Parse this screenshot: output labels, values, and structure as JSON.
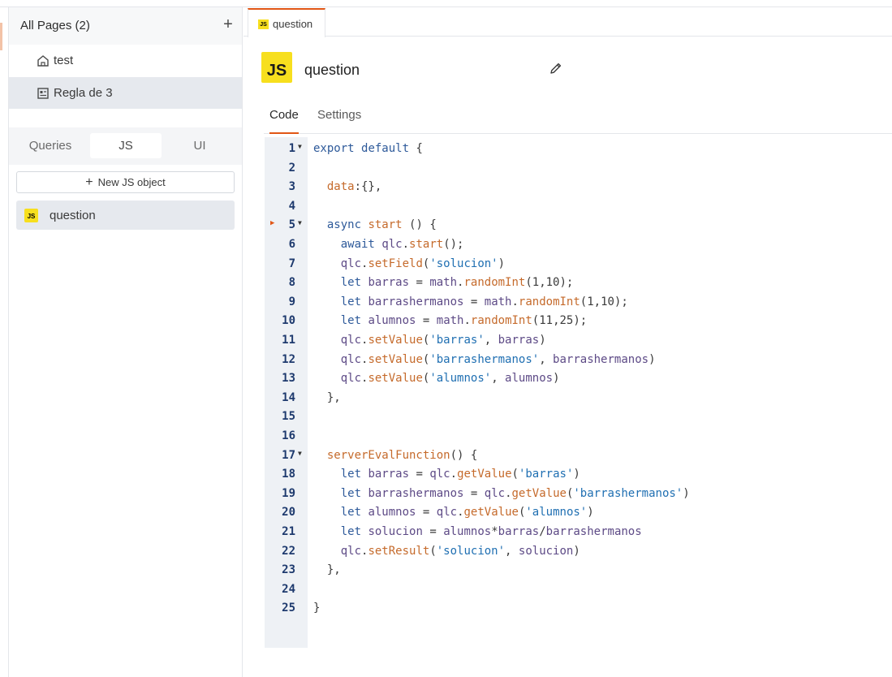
{
  "sidebar": {
    "pages_title": "All Pages (2)",
    "add_icon": "+",
    "pages": [
      {
        "label": "test",
        "icon": "home-icon",
        "active": false
      },
      {
        "label": "Regla de 3",
        "icon": "page-icon",
        "active": true
      }
    ],
    "segment_tabs": [
      {
        "label": "Queries",
        "active": false
      },
      {
        "label": "JS",
        "active": true
      },
      {
        "label": "UI",
        "active": false
      }
    ],
    "new_js_label": "New JS object",
    "js_objects": [
      {
        "label": "question",
        "badge": "JS"
      }
    ]
  },
  "tabbar": {
    "file_tab_label": "question",
    "file_tab_badge": "JS"
  },
  "header": {
    "badge": "JS",
    "title": "question"
  },
  "subtabs": [
    {
      "label": "Code",
      "active": true
    },
    {
      "label": "Settings",
      "active": false
    }
  ],
  "editor": {
    "lines": [
      {
        "n": "1",
        "fold": true,
        "text": "export default {"
      },
      {
        "n": "2",
        "text": ""
      },
      {
        "n": "3",
        "text": "  data:{},"
      },
      {
        "n": "4",
        "text": ""
      },
      {
        "n": "5",
        "fold": true,
        "breakpoint": true,
        "text": "  async start () {"
      },
      {
        "n": "6",
        "text": "    await qlc.start();"
      },
      {
        "n": "7",
        "text": "    qlc.setField('solucion')"
      },
      {
        "n": "8",
        "text": "    let barras = math.randomInt(1,10);"
      },
      {
        "n": "9",
        "text": "    let barrashermanos = math.randomInt(1,10);"
      },
      {
        "n": "10",
        "text": "    let alumnos = math.randomInt(11,25);"
      },
      {
        "n": "11",
        "text": "    qlc.setValue('barras', barras)"
      },
      {
        "n": "12",
        "text": "    qlc.setValue('barrashermanos', barrashermanos)"
      },
      {
        "n": "13",
        "text": "    qlc.setValue('alumnos', alumnos)"
      },
      {
        "n": "14",
        "text": "  },"
      },
      {
        "n": "15",
        "text": ""
      },
      {
        "n": "16",
        "text": ""
      },
      {
        "n": "17",
        "fold": true,
        "text": "  serverEvalFunction() {"
      },
      {
        "n": "18",
        "text": "    let barras = qlc.getValue('barras')"
      },
      {
        "n": "19",
        "text": "    let barrashermanos = qlc.getValue('barrashermanos')"
      },
      {
        "n": "20",
        "text": "    let alumnos = qlc.getValue('alumnos')"
      },
      {
        "n": "21",
        "text": "    let solucion = alumnos*barras/barrashermanos"
      },
      {
        "n": "22",
        "text": "    qlc.setResult('solucion', solucion)"
      },
      {
        "n": "23",
        "text": "  },"
      },
      {
        "n": "24",
        "text": ""
      },
      {
        "n": "25",
        "text": "}"
      }
    ]
  },
  "colors": {
    "accent": "#e15615",
    "js_yellow": "#f7df1e",
    "gutter_bg": "#eef1f5",
    "active_item_bg": "#e6e9ee"
  }
}
